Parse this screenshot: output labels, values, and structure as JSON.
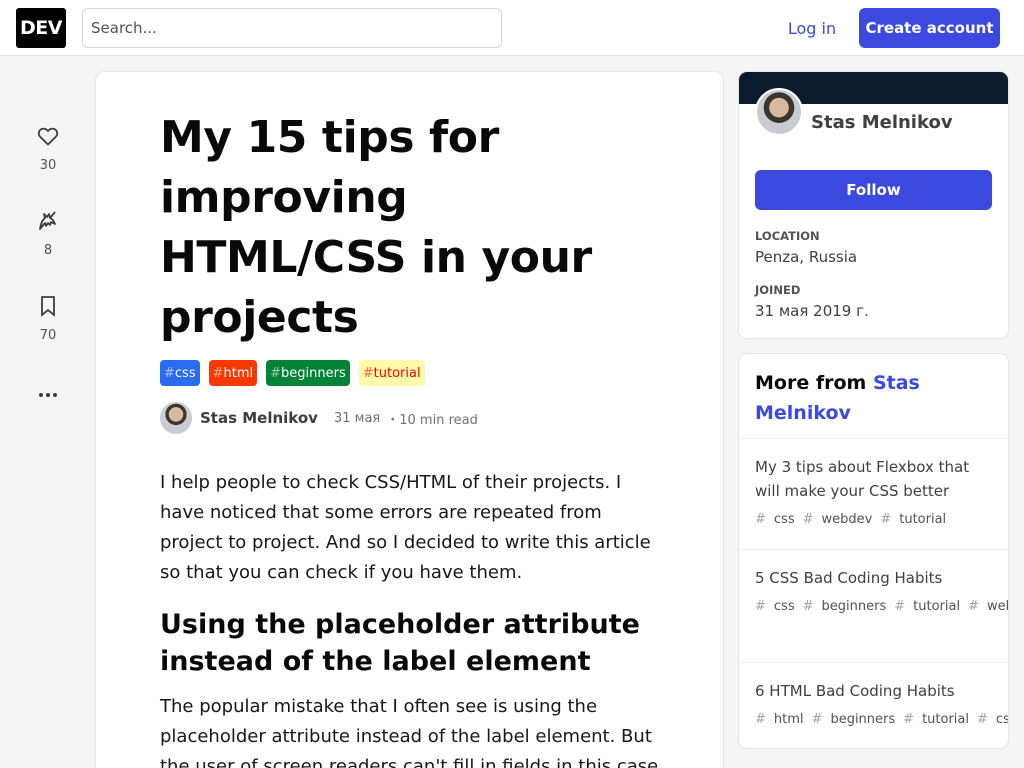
{
  "header": {
    "logo": "DEV",
    "search_placeholder": "Search...",
    "login_label": "Log in",
    "create_account_label": "Create account"
  },
  "reactions": {
    "hearts": "30",
    "unicorns": "8",
    "bookmarks": "70",
    "more": "..."
  },
  "article": {
    "title": "My 15 tips for improving HTML/CSS in your projects",
    "tags": [
      {
        "name": "css",
        "bg": "#2a6cf0",
        "fg": "#ffffff"
      },
      {
        "name": "html",
        "bg": "#f53900",
        "fg": "#ffffff"
      },
      {
        "name": "beginners",
        "bg": "#008335",
        "fg": "#ffffff"
      },
      {
        "name": "tutorial",
        "bg": "#fffaa8",
        "fg": "#ff0000"
      }
    ],
    "author": "Stas Melnikov",
    "date": "31 мая",
    "read_time": "・10 min read",
    "intro": "I help people to check CSS/HTML of their projects. I have noticed that some errors are repeated from project to project. And so I decided to write this article so that you can check if you have them.",
    "section_heading": "Using the placeholder attribute instead of the label element",
    "section_text": "The popular mistake that I often see is using the placeholder attribute instead of the label element. But the user of screen readers can't fill in fields in this case"
  },
  "profile": {
    "name": "Stas Melnikov",
    "follow_label": "Follow",
    "location_label": "LOCATION",
    "location": "Penza, Russia",
    "joined_label": "JOINED",
    "joined": "31 мая 2019 г."
  },
  "more_from": {
    "prefix": "More from ",
    "author": "Stas Melnikov",
    "items": [
      {
        "title": "My 3 tips about Flexbox that will make your CSS better",
        "tags": [
          "css",
          "webdev",
          "tutorial"
        ]
      },
      {
        "title": "5 CSS Bad Coding Habits",
        "tags": [
          "css",
          "beginners",
          "tutorial",
          "webdev"
        ]
      },
      {
        "title": "6 HTML Bad Coding Habits",
        "tags": [
          "html",
          "beginners",
          "tutorial",
          "css"
        ]
      }
    ]
  },
  "colors": {
    "accent": "#3b49df",
    "profile_band": "#0a1c2b"
  }
}
